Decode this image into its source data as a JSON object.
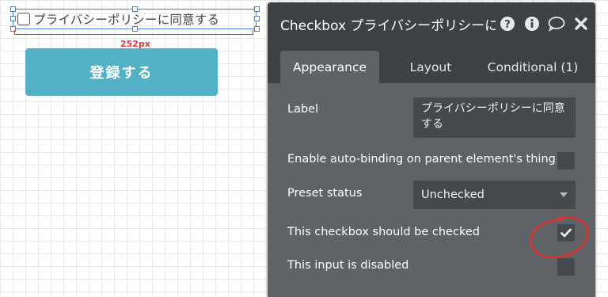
{
  "canvas": {
    "checkbox_label": "プライバシーポリシーに同意する",
    "width_badge": "252px",
    "register_button": "登録する"
  },
  "panel": {
    "title": "Checkbox プライバシーポリシーに",
    "header_icons": [
      "help-icon",
      "info-icon",
      "comment-icon",
      "close-icon"
    ],
    "tabs": [
      {
        "label": "Appearance",
        "active": true
      },
      {
        "label": "Layout",
        "active": false
      },
      {
        "label": "Conditional (1)",
        "active": false
      }
    ],
    "fields": {
      "label": {
        "name": "Label",
        "value": "プライバシーポリシーに同意する"
      },
      "auto_binding": {
        "name": "Enable auto-binding on parent element's thing",
        "checked": false
      },
      "preset_status": {
        "name": "Preset status",
        "value": "Unchecked"
      },
      "should_be_checked": {
        "name": "This checkbox should be checked",
        "checked": true
      },
      "disabled": {
        "name": "This input is disabled",
        "checked": false
      }
    }
  },
  "colors": {
    "selection": "#4a7fe0",
    "dimension_marker": "#e23b3b",
    "button": "#52b1c4",
    "panel_header": "#3d4247",
    "panel_body": "#5e6368",
    "field_bg": "#44494e",
    "annotation": "#e0312b"
  }
}
